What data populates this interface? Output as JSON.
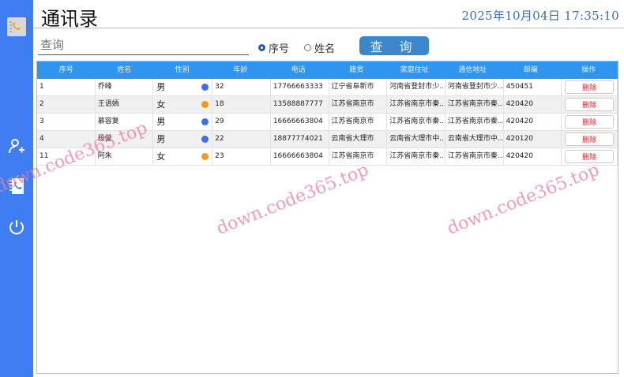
{
  "app": {
    "title": "通讯录",
    "datetime": "2025年10月04日  17:35:10"
  },
  "sidebar": {
    "items": [
      "phonebook-icon",
      "add-user-icon",
      "contacts-icon",
      "power-icon"
    ]
  },
  "search": {
    "placeholder": "查询",
    "value": "",
    "options": [
      {
        "label": "序号",
        "selected": true
      },
      {
        "label": "姓名",
        "selected": false
      }
    ],
    "button_label": "查 询"
  },
  "table": {
    "columns": [
      "序号",
      "姓名",
      "性别",
      "年龄",
      "电话",
      "籍贯",
      "家庭住址",
      "通信地址",
      "邮编",
      "操作"
    ],
    "rows": [
      {
        "id": "1",
        "name": "乔峰",
        "gender": "男",
        "age": "32",
        "phone": "17766663333",
        "origin": "辽宁省阜新市",
        "home": "河南省登封市少...",
        "mail": "河南省登封市少...",
        "zip": "450451",
        "action": "删除"
      },
      {
        "id": "2",
        "name": "王语嫣",
        "gender": "女",
        "age": "18",
        "phone": "13588887777",
        "origin": "江苏省南京市",
        "home": "江苏省南京市秦...",
        "mail": "江苏省南京市秦...",
        "zip": "420420",
        "action": "删除"
      },
      {
        "id": "3",
        "name": "慕容复",
        "gender": "男",
        "age": "29",
        "phone": "16666663804",
        "origin": "江苏省南京市",
        "home": "江苏省南京市秦...",
        "mail": "江苏省南京市秦...",
        "zip": "420420",
        "action": "删除"
      },
      {
        "id": "4",
        "name": "段誉",
        "gender": "男",
        "age": "22",
        "phone": "18877774021",
        "origin": "云南省大理市",
        "home": "云南省大理市中...",
        "mail": "云南省大理市中...",
        "zip": "420120",
        "action": "删除"
      },
      {
        "id": "11",
        "name": "阿朱",
        "gender": "女",
        "age": "23",
        "phone": "16666663804",
        "origin": "江苏省南京市",
        "home": "江苏省南京市秦...",
        "mail": "江苏省南京市秦...",
        "zip": "420420",
        "action": "删除"
      }
    ]
  },
  "colors": {
    "sidebar": "#3f7ef2",
    "header": "#2f95ef",
    "male": "#3b6ff0",
    "female": "#f39a12",
    "delete": "#dd2222"
  },
  "watermark": "down.code365.top"
}
